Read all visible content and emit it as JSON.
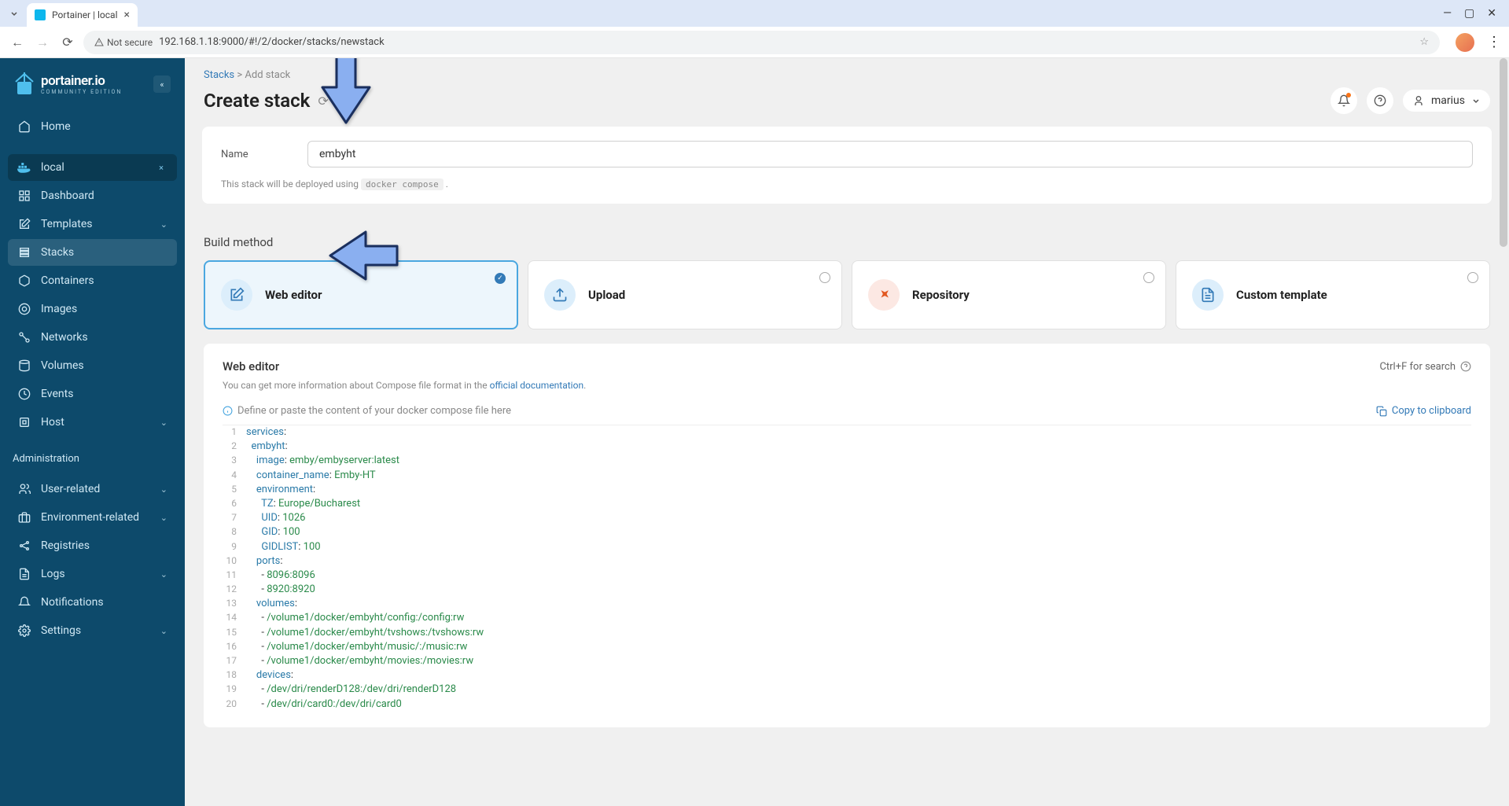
{
  "browser": {
    "tab_title": "Portainer | local",
    "url": "192.168.1.18:9000/#!/2/docker/stacks/newstack",
    "not_secure_label": "Not secure"
  },
  "logo": {
    "title": "portainer.io",
    "sub": "COMMUNITY EDITION"
  },
  "sidebar": {
    "home": "Home",
    "env_label": "local",
    "items": [
      "Dashboard",
      "Templates",
      "Stacks",
      "Containers",
      "Images",
      "Networks",
      "Volumes",
      "Events",
      "Host"
    ],
    "admin_title": "Administration",
    "admin_items": [
      "User-related",
      "Environment-related",
      "Registries",
      "Logs",
      "Notifications",
      "Settings"
    ]
  },
  "breadcrumb": {
    "root": "Stacks",
    "current": "Add stack"
  },
  "page_title": "Create stack",
  "user": "marius",
  "form": {
    "name_label": "Name",
    "name_value": "embyht",
    "deploy_hint": "This stack will be deployed using",
    "deploy_code": "docker compose"
  },
  "build_method": {
    "heading": "Build method",
    "options": [
      "Web editor",
      "Upload",
      "Repository",
      "Custom template"
    ]
  },
  "editor": {
    "title": "Web editor",
    "search_hint": "Ctrl+F for search",
    "info": "You can get more information about Compose file format in the",
    "info_link": "official documentation",
    "define_hint": "Define or paste the content of your docker compose file here",
    "copy_label": "Copy to clipboard"
  },
  "code": [
    {
      "n": 1,
      "i": 0,
      "k": "services",
      "v": ""
    },
    {
      "n": 2,
      "i": 1,
      "k": "embyht",
      "v": ""
    },
    {
      "n": 3,
      "i": 2,
      "k": "image",
      "v": "emby/embyserver:latest"
    },
    {
      "n": 4,
      "i": 2,
      "k": "container_name",
      "v": "Emby-HT"
    },
    {
      "n": 5,
      "i": 2,
      "k": "environment",
      "v": ""
    },
    {
      "n": 6,
      "i": 3,
      "k": "TZ",
      "v": "Europe/Bucharest"
    },
    {
      "n": 7,
      "i": 3,
      "k": "UID",
      "v": "1026"
    },
    {
      "n": 8,
      "i": 3,
      "k": "GID",
      "v": "100"
    },
    {
      "n": 9,
      "i": 3,
      "k": "GIDLIST",
      "v": "100"
    },
    {
      "n": 10,
      "i": 2,
      "k": "ports",
      "v": ""
    },
    {
      "n": 11,
      "i": 3,
      "k": "-",
      "v": "8096:8096"
    },
    {
      "n": 12,
      "i": 3,
      "k": "-",
      "v": "8920:8920"
    },
    {
      "n": 13,
      "i": 2,
      "k": "volumes",
      "v": ""
    },
    {
      "n": 14,
      "i": 3,
      "k": "-",
      "v": "/volume1/docker/embyht/config:/config:rw"
    },
    {
      "n": 15,
      "i": 3,
      "k": "-",
      "v": "/volume1/docker/embyht/tvshows:/tvshows:rw"
    },
    {
      "n": 16,
      "i": 3,
      "k": "-",
      "v": "/volume1/docker/embyht/music/:/music:rw"
    },
    {
      "n": 17,
      "i": 3,
      "k": "-",
      "v": "/volume1/docker/embyht/movies:/movies:rw"
    },
    {
      "n": 18,
      "i": 2,
      "k": "devices",
      "v": ""
    },
    {
      "n": 19,
      "i": 3,
      "k": "-",
      "v": "/dev/dri/renderD128:/dev/dri/renderD128"
    },
    {
      "n": 20,
      "i": 3,
      "k": "-",
      "v": "/dev/dri/card0:/dev/dri/card0"
    }
  ]
}
